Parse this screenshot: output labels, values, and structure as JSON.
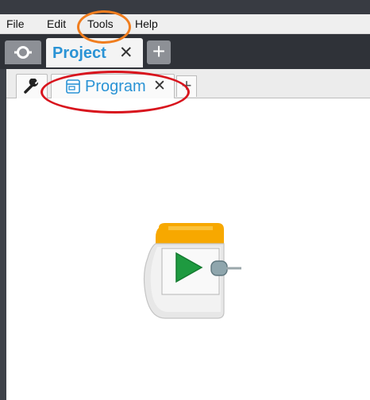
{
  "menu": {
    "file": "File",
    "edit": "Edit",
    "tools": "Tools",
    "help": "Help"
  },
  "project_bar": {
    "home_icon": "lobby-icon",
    "project_tab_label": "Project",
    "close_icon": "close-icon",
    "add_icon": "plus-icon"
  },
  "program_bar": {
    "settings_icon": "wrench-icon",
    "program_tab_label": "Program",
    "program_icon": "program-file-icon",
    "close_icon": "close-icon",
    "add_icon": "plus-icon"
  },
  "canvas": {
    "start_block_icon": "play-icon",
    "start_block_color": "#f7a800",
    "play_color": "#1e9a40"
  },
  "annotations": {
    "tools_highlight_color": "#f07d1e",
    "program_highlight_color": "#d8141d"
  },
  "colors": {
    "accent": "#2a93d5",
    "dark_bg": "#2f3238"
  }
}
